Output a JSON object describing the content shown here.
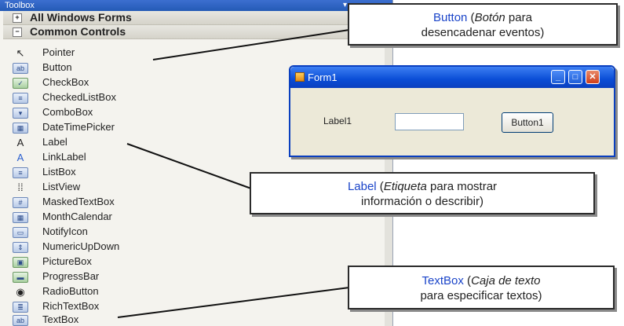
{
  "toolbox": {
    "title": "Toolbox",
    "pin_glyph": "▾",
    "sections": [
      {
        "label": "All Windows Forms",
        "toggle": "+"
      },
      {
        "label": "Common Controls",
        "toggle": "−"
      }
    ],
    "items": [
      {
        "label": "Pointer",
        "icon": "pointer-icon",
        "glyph": "↖"
      },
      {
        "label": "Button",
        "icon": "button-icon",
        "glyph": "ab"
      },
      {
        "label": "CheckBox",
        "icon": "checkbox-icon",
        "glyph": "✓"
      },
      {
        "label": "CheckedListBox",
        "icon": "checked-list-box-icon",
        "glyph": "≡"
      },
      {
        "label": "ComboBox",
        "icon": "combobox-icon",
        "glyph": "▾"
      },
      {
        "label": "DateTimePicker",
        "icon": "date-time-picker-icon",
        "glyph": "▦"
      },
      {
        "label": "Label",
        "icon": "label-icon",
        "glyph": "A"
      },
      {
        "label": "LinkLabel",
        "icon": "link-label-icon",
        "glyph": "A"
      },
      {
        "label": "ListBox",
        "icon": "listbox-icon",
        "glyph": "≡"
      },
      {
        "label": "ListView",
        "icon": "listview-icon",
        "glyph": "⁞⁞"
      },
      {
        "label": "MaskedTextBox",
        "icon": "masked-textbox-icon",
        "glyph": "#"
      },
      {
        "label": "MonthCalendar",
        "icon": "month-calendar-icon",
        "glyph": "▦"
      },
      {
        "label": "NotifyIcon",
        "icon": "notify-icon-icon",
        "glyph": "▭"
      },
      {
        "label": "NumericUpDown",
        "icon": "numeric-updown-icon",
        "glyph": "⇕"
      },
      {
        "label": "PictureBox",
        "icon": "picturebox-icon",
        "glyph": "▣"
      },
      {
        "label": "ProgressBar",
        "icon": "progressbar-icon",
        "glyph": "▬"
      },
      {
        "label": "RadioButton",
        "icon": "radio-button-icon",
        "glyph": "◉"
      },
      {
        "label": "RichTextBox",
        "icon": "rich-textbox-icon",
        "glyph": "≣"
      },
      {
        "label": "TextBox",
        "icon": "textbox-icon",
        "glyph": "ab"
      }
    ]
  },
  "callouts": {
    "button": {
      "keyword": "Button",
      "open_paren": " (",
      "italic": "Botón",
      "rest": " para",
      "line2": "desencadenar eventos)"
    },
    "label": {
      "keyword": "Label",
      "open_paren": " (",
      "italic": "Etiqueta",
      "rest": " para mostrar",
      "line2": "información o describir)"
    },
    "textbox": {
      "keyword": "TextBox",
      "open_paren": " (",
      "italic": "Caja de texto",
      "rest": "",
      "line2": "para especificar textos)"
    }
  },
  "form": {
    "title": "Form1",
    "label_text": "Label1",
    "textbox_value": "",
    "button_label": "Button1",
    "minimize_glyph": "_",
    "maximize_glyph": "□",
    "close_glyph": "✕"
  },
  "colors": {
    "callout_keyword": "#1a44c9",
    "titlebar": "#0a4dd6",
    "close_button": "#cf3f1b"
  }
}
